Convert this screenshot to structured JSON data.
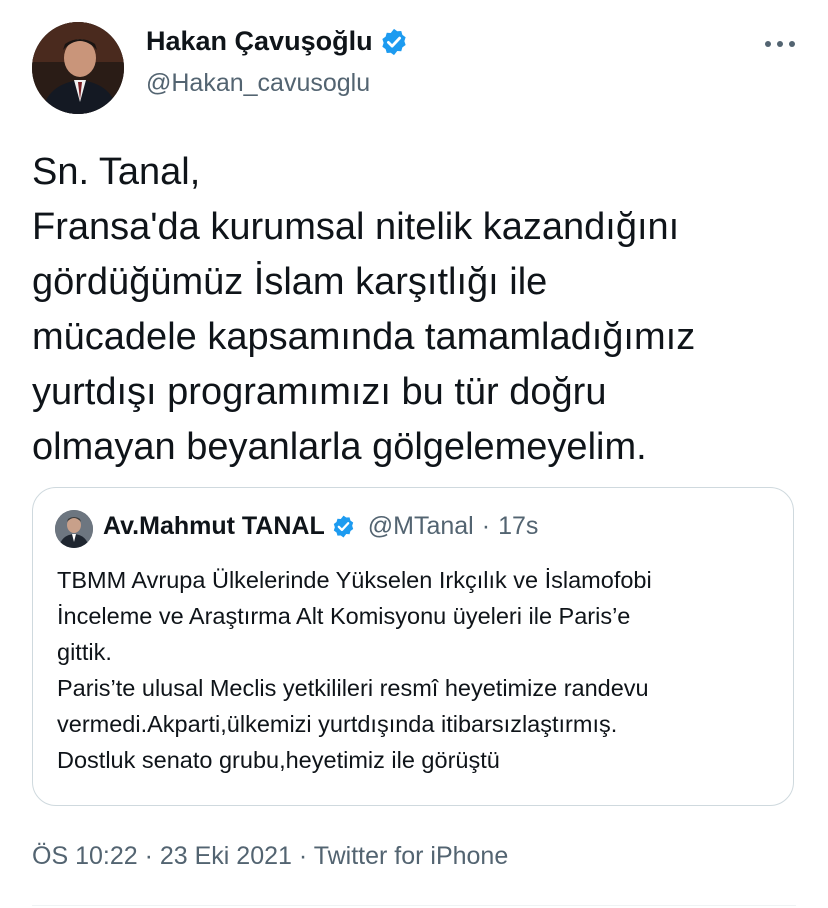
{
  "author": {
    "name": "Hakan Çavuşoğlu",
    "handle": "@Hakan_cavusoglu",
    "verified": true
  },
  "tweet": {
    "text": "Sn. Tanal,\nFransa'da kurumsal nitelik kazandığını\ngördüğümüz İslam karşıtlığı ile\nmücadele kapsamında tamamladığımız\nyurtdışı programımızı bu tür doğru\nolmayan beyanlarla gölgelemeyelim."
  },
  "quoted_tweet": {
    "name": "Av.Mahmut TANAL",
    "handle": "@MTanal",
    "time": "17s",
    "separator": "·",
    "verified": true,
    "text": "TBMM Avrupa Ülkelerinde Yükselen Irkçılık ve İslamofobi\nİnceleme ve Araştırma Alt Komisyonu üyeleri ile Paris’e\ngittik.\nParis’te ulusal Meclis yetkilileri resmî heyetimize randevu\nvermedi.Akparti,ülkemizi yurtdışında itibarsızlaştırmış.\nDostluk senato grubu,heyetimiz ile görüştü"
  },
  "meta": {
    "time": "ÖS 10:22",
    "date": "23 Eki 2021",
    "source": "Twitter for iPhone",
    "separator": "·"
  },
  "icons": {
    "verified": "verified-badge-icon",
    "more": "more-options-icon"
  },
  "colors": {
    "verified_blue": "#1d9bf0",
    "secondary_text": "#536471",
    "border": "#cfd9de"
  }
}
